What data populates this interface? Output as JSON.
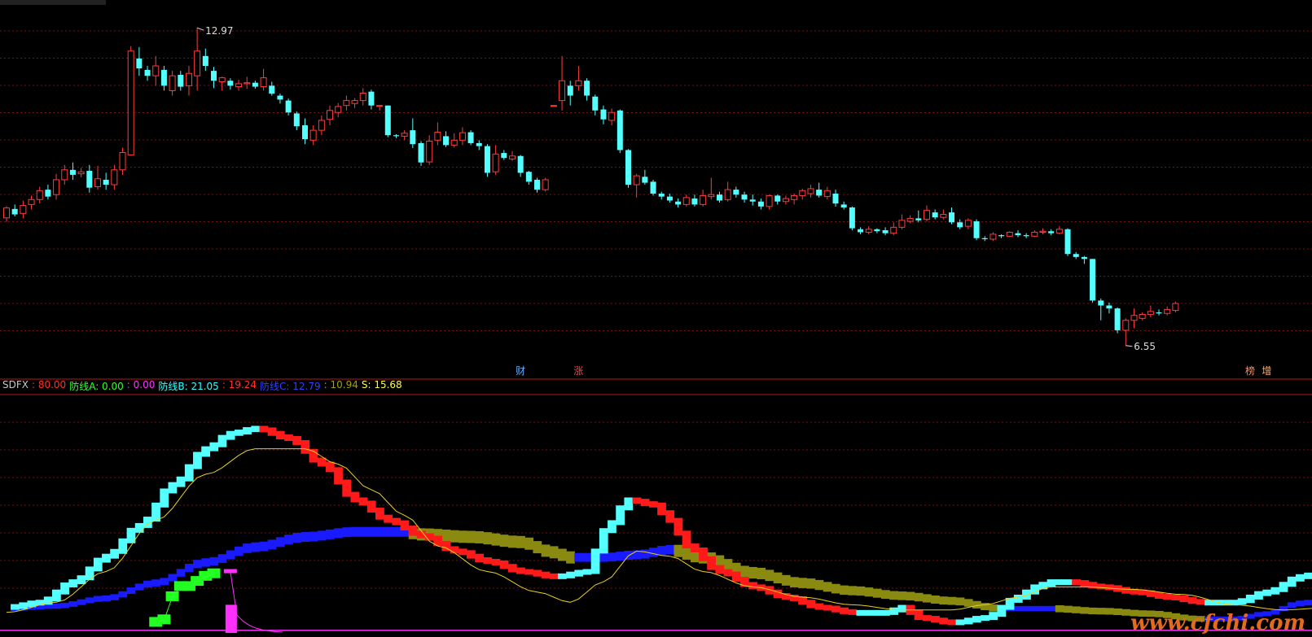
{
  "chart_data": [
    {
      "type": "candlestick",
      "price_high_label": "12.97",
      "price_low_label": "6.55",
      "ylim": [
        6.3,
        13.4
      ],
      "candles": [
        [
          9.13,
          9.33,
          9.05,
          9.37
        ],
        [
          9.31,
          9.2,
          9.16,
          9.4
        ],
        [
          9.22,
          9.38,
          9.12,
          9.48
        ],
        [
          9.4,
          9.5,
          9.3,
          9.58
        ],
        [
          9.5,
          9.68,
          9.42,
          9.76
        ],
        [
          9.7,
          9.56,
          9.5,
          9.8
        ],
        [
          9.6,
          9.9,
          9.5,
          10.02
        ],
        [
          9.9,
          10.1,
          9.8,
          10.2
        ],
        [
          10.1,
          10.0,
          9.9,
          10.25
        ],
        [
          10.02,
          10.06,
          9.95,
          10.14
        ],
        [
          10.08,
          9.74,
          9.64,
          10.2
        ],
        [
          9.76,
          9.92,
          9.7,
          10.18
        ],
        [
          9.9,
          9.8,
          9.7,
          10.04
        ],
        [
          9.8,
          10.1,
          9.7,
          10.2
        ],
        [
          10.1,
          10.45,
          10.0,
          10.55
        ],
        [
          10.4,
          12.5,
          10.4,
          12.6
        ],
        [
          12.35,
          12.15,
          12.0,
          12.58
        ],
        [
          12.12,
          12.0,
          11.9,
          12.2
        ],
        [
          12.0,
          12.2,
          11.8,
          12.4
        ],
        [
          12.12,
          11.8,
          11.7,
          12.2
        ],
        [
          11.7,
          12.0,
          11.6,
          12.1
        ],
        [
          12.02,
          11.78,
          11.7,
          12.1
        ],
        [
          11.8,
          12.05,
          11.6,
          12.2
        ],
        [
          12.0,
          12.5,
          11.7,
          12.97
        ],
        [
          12.4,
          12.2,
          12.1,
          12.55
        ],
        [
          12.1,
          11.9,
          11.75,
          12.18
        ],
        [
          11.88,
          11.96,
          11.7,
          11.98
        ],
        [
          11.9,
          11.8,
          11.72,
          11.95
        ],
        [
          11.78,
          11.84,
          11.7,
          11.92
        ],
        [
          11.84,
          11.86,
          11.74,
          11.98
        ],
        [
          11.86,
          11.78,
          11.74,
          11.9
        ],
        [
          11.78,
          11.96,
          11.7,
          12.14
        ],
        [
          11.8,
          11.64,
          11.6,
          11.88
        ],
        [
          11.6,
          11.52,
          11.44,
          11.64
        ],
        [
          11.5,
          11.26,
          11.2,
          11.54
        ],
        [
          11.24,
          10.98,
          10.9,
          11.28
        ],
        [
          11.0,
          10.72,
          10.62,
          11.14
        ],
        [
          10.7,
          10.9,
          10.6,
          11.0
        ],
        [
          10.9,
          11.1,
          10.8,
          11.2
        ],
        [
          11.12,
          11.3,
          11.0,
          11.4
        ],
        [
          11.26,
          11.38,
          11.16,
          11.45
        ],
        [
          11.4,
          11.5,
          11.3,
          11.6
        ],
        [
          11.44,
          11.5,
          11.35,
          11.55
        ],
        [
          11.5,
          11.65,
          11.4,
          11.75
        ],
        [
          11.68,
          11.4,
          11.32,
          11.72
        ],
        [
          11.4,
          11.4,
          11.3,
          11.4
        ],
        [
          11.4,
          10.8,
          10.76,
          11.4
        ],
        [
          10.8,
          10.78,
          10.74,
          10.82
        ],
        [
          10.78,
          10.84,
          10.7,
          10.9
        ],
        [
          10.9,
          10.62,
          10.54,
          11.14
        ],
        [
          10.64,
          10.25,
          10.18,
          10.68
        ],
        [
          10.26,
          10.68,
          10.2,
          10.8
        ],
        [
          10.7,
          10.86,
          10.6,
          11.06
        ],
        [
          10.78,
          10.6,
          10.56,
          10.88
        ],
        [
          10.6,
          10.7,
          10.55,
          10.84
        ],
        [
          10.7,
          10.85,
          10.6,
          10.96
        ],
        [
          10.86,
          10.64,
          10.6,
          10.9
        ],
        [
          10.64,
          10.58,
          10.5,
          10.7
        ],
        [
          10.58,
          10.04,
          9.96,
          10.62
        ],
        [
          10.06,
          10.42,
          10.0,
          10.6
        ],
        [
          10.44,
          10.34,
          10.3,
          10.5
        ],
        [
          10.32,
          10.38,
          10.28,
          10.48
        ],
        [
          10.38,
          10.04,
          9.96,
          10.4
        ],
        [
          10.06,
          9.86,
          9.8,
          10.08
        ],
        [
          9.9,
          9.7,
          9.64,
          9.94
        ],
        [
          9.7,
          9.9,
          9.66,
          9.94
        ],
        [
          11.4,
          11.4,
          11.4,
          11.4
        ],
        [
          11.5,
          11.9,
          11.3,
          12.4
        ],
        [
          11.8,
          11.6,
          11.4,
          11.9
        ],
        [
          11.8,
          11.9,
          11.7,
          12.2
        ],
        [
          11.9,
          11.6,
          11.5,
          11.95
        ],
        [
          11.58,
          11.3,
          11.2,
          11.62
        ],
        [
          11.32,
          11.12,
          11.02,
          11.4
        ],
        [
          11.1,
          11.26,
          11.0,
          11.34
        ],
        [
          11.3,
          10.5,
          10.44,
          11.32
        ],
        [
          10.5,
          9.8,
          9.74,
          10.52
        ],
        [
          9.8,
          9.98,
          9.54,
          10.02
        ],
        [
          9.96,
          9.84,
          9.8,
          10.1
        ],
        [
          9.86,
          9.62,
          9.58,
          9.9
        ],
        [
          9.62,
          9.56,
          9.5,
          9.66
        ],
        [
          9.56,
          9.48,
          9.44,
          9.62
        ],
        [
          9.46,
          9.4,
          9.34,
          9.52
        ],
        [
          9.4,
          9.54,
          9.36,
          9.6
        ],
        [
          9.52,
          9.4,
          9.36,
          9.6
        ],
        [
          9.4,
          9.58,
          9.36,
          9.7
        ],
        [
          9.56,
          9.6,
          9.5,
          9.94
        ],
        [
          9.6,
          9.48,
          9.44,
          9.66
        ],
        [
          9.5,
          9.7,
          9.46,
          9.86
        ],
        [
          9.7,
          9.6,
          9.54,
          9.76
        ],
        [
          9.6,
          9.5,
          9.44,
          9.66
        ],
        [
          9.5,
          9.46,
          9.38,
          9.6
        ],
        [
          9.46,
          9.36,
          9.3,
          9.52
        ],
        [
          9.36,
          9.58,
          9.3,
          9.6
        ],
        [
          9.58,
          9.46,
          9.4,
          9.6
        ],
        [
          9.46,
          9.52,
          9.4,
          9.58
        ],
        [
          9.5,
          9.58,
          9.4,
          9.62
        ],
        [
          9.58,
          9.68,
          9.5,
          9.72
        ],
        [
          9.62,
          9.72,
          9.54,
          9.8
        ],
        [
          9.7,
          9.58,
          9.54,
          9.84
        ],
        [
          9.56,
          9.68,
          9.5,
          9.76
        ],
        [
          9.62,
          9.42,
          9.36,
          9.7
        ],
        [
          9.4,
          9.34,
          9.3,
          9.46
        ],
        [
          9.34,
          8.92,
          8.88,
          9.36
        ],
        [
          8.9,
          8.84,
          8.8,
          8.94
        ],
        [
          8.84,
          8.9,
          8.8,
          8.96
        ],
        [
          8.9,
          8.86,
          8.82,
          8.92
        ],
        [
          8.88,
          8.82,
          8.78,
          8.94
        ],
        [
          8.82,
          8.94,
          8.78,
          9.04
        ],
        [
          8.94,
          9.08,
          8.9,
          9.2
        ],
        [
          9.06,
          9.12,
          9.02,
          9.18
        ],
        [
          9.12,
          9.08,
          9.04,
          9.28
        ],
        [
          9.1,
          9.28,
          9.06,
          9.38
        ],
        [
          9.24,
          9.14,
          9.1,
          9.3
        ],
        [
          9.14,
          9.2,
          9.1,
          9.3
        ],
        [
          9.24,
          9.04,
          9.0,
          9.34
        ],
        [
          9.04,
          8.94,
          8.9,
          9.1
        ],
        [
          8.96,
          9.08,
          8.9,
          9.12
        ],
        [
          9.06,
          8.72,
          8.68,
          9.1
        ],
        [
          8.72,
          8.7,
          8.66,
          8.76
        ],
        [
          8.7,
          8.8,
          8.66,
          8.84
        ],
        [
          8.78,
          8.76,
          8.72,
          8.8
        ],
        [
          8.76,
          8.84,
          8.74,
          8.86
        ],
        [
          8.82,
          8.78,
          8.74,
          8.88
        ],
        [
          8.78,
          8.76,
          8.72,
          8.82
        ],
        [
          8.76,
          8.84,
          8.74,
          8.88
        ],
        [
          8.84,
          8.86,
          8.8,
          8.92
        ],
        [
          8.86,
          8.82,
          8.78,
          8.9
        ],
        [
          8.82,
          8.9,
          8.8,
          8.96
        ],
        [
          8.9,
          8.4,
          8.36,
          8.92
        ],
        [
          8.4,
          8.34,
          8.3,
          8.44
        ],
        [
          8.34,
          8.3,
          8.2,
          8.36
        ],
        [
          8.3,
          7.46,
          7.42,
          8.3
        ],
        [
          7.46,
          7.36,
          7.06,
          7.5
        ],
        [
          7.36,
          7.3,
          7.2,
          7.42
        ],
        [
          7.3,
          6.86,
          6.8,
          7.32
        ],
        [
          6.86,
          7.06,
          6.55,
          7.1
        ],
        [
          7.06,
          7.16,
          6.9,
          7.3
        ],
        [
          7.1,
          7.18,
          7.06,
          7.22
        ],
        [
          7.18,
          7.24,
          7.12,
          7.36
        ],
        [
          7.22,
          7.2,
          7.16,
          7.28
        ],
        [
          7.2,
          7.28,
          7.16,
          7.34
        ],
        [
          7.26,
          7.4,
          7.22,
          7.44
        ]
      ],
      "markers": [
        {
          "label": "财",
          "index": 62,
          "color": "#6ab0ff"
        },
        {
          "label": "涨",
          "index": 69,
          "color": "#ff4040"
        },
        {
          "label": "榜",
          "index": 150,
          "color": "#ff8a5a"
        },
        {
          "label": "增",
          "index": 152,
          "color": "#ffb070"
        }
      ]
    },
    {
      "type": "indicator",
      "ylim": [
        0,
        90
      ],
      "legend": [
        {
          "text": "SDFX",
          "color": "#c8c8c8"
        },
        {
          "text": ": 80.00",
          "color": "#ff3030"
        },
        {
          "text": "防线A: 0.00",
          "color": "#30ff30"
        },
        {
          "text": ": 0.00",
          "color": "#ff30ff"
        },
        {
          "text": "防线B: 21.05",
          "color": "#30ffff"
        },
        {
          "text": ": 19.24",
          "color": "#ff3030"
        },
        {
          "text": "防线C: 12.79",
          "color": "#3040ff"
        },
        {
          "text": ": 10.94",
          "color": "#a0a000"
        },
        {
          "text": "S: 15.68",
          "color": "#ffff40"
        }
      ],
      "band_b_anchors": [
        [
          0,
          10
        ],
        [
          4,
          12
        ],
        [
          8,
          20
        ],
        [
          12,
          30
        ],
        [
          16,
          42
        ],
        [
          20,
          58
        ],
        [
          24,
          72
        ],
        [
          27,
          78
        ],
        [
          30,
          80
        ],
        [
          34,
          76
        ],
        [
          38,
          66
        ],
        [
          42,
          52
        ],
        [
          46,
          44
        ],
        [
          50,
          38
        ],
        [
          54,
          32
        ],
        [
          58,
          28
        ],
        [
          62,
          24
        ],
        [
          66,
          22
        ],
        [
          70,
          24
        ],
        [
          72,
          40
        ],
        [
          75,
          52
        ],
        [
          78,
          50
        ],
        [
          80,
          44
        ],
        [
          82,
          34
        ],
        [
          86,
          24
        ],
        [
          90,
          18
        ],
        [
          94,
          14
        ],
        [
          98,
          10
        ],
        [
          102,
          8
        ],
        [
          106,
          8
        ],
        [
          108,
          10
        ],
        [
          110,
          6
        ],
        [
          114,
          4
        ],
        [
          118,
          6
        ],
        [
          122,
          14
        ],
        [
          124,
          18
        ],
        [
          126,
          20
        ],
        [
          128,
          20
        ],
        [
          132,
          18
        ],
        [
          136,
          16
        ],
        [
          140,
          14
        ],
        [
          144,
          12
        ],
        [
          148,
          12
        ],
        [
          152,
          16
        ],
        [
          156,
          22
        ],
        [
          160,
          26
        ]
      ],
      "band_c_anchors": [
        [
          0,
          10
        ],
        [
          6,
          11
        ],
        [
          12,
          14
        ],
        [
          18,
          20
        ],
        [
          24,
          28
        ],
        [
          30,
          34
        ],
        [
          36,
          38
        ],
        [
          42,
          40
        ],
        [
          46,
          40
        ],
        [
          48,
          40
        ],
        [
          50,
          39
        ],
        [
          56,
          38
        ],
        [
          62,
          36
        ],
        [
          66,
          32
        ],
        [
          68,
          30
        ],
        [
          72,
          30
        ],
        [
          76,
          31
        ],
        [
          80,
          33
        ],
        [
          84,
          30
        ],
        [
          90,
          24
        ],
        [
          96,
          20
        ],
        [
          102,
          17
        ],
        [
          108,
          15
        ],
        [
          114,
          13
        ],
        [
          120,
          10
        ],
        [
          126,
          10
        ],
        [
          132,
          9
        ],
        [
          138,
          8
        ],
        [
          144,
          6
        ],
        [
          148,
          6
        ],
        [
          152,
          8
        ],
        [
          156,
          12
        ],
        [
          160,
          14
        ]
      ],
      "s_anchors": [
        [
          0,
          8
        ],
        [
          6,
          12
        ],
        [
          12,
          24
        ],
        [
          18,
          44
        ],
        [
          24,
          62
        ],
        [
          30,
          72
        ],
        [
          36,
          72
        ],
        [
          40,
          66
        ],
        [
          44,
          56
        ],
        [
          48,
          46
        ],
        [
          52,
          34
        ],
        [
          58,
          24
        ],
        [
          64,
          16
        ],
        [
          68,
          12
        ],
        [
          72,
          20
        ],
        [
          76,
          32
        ],
        [
          80,
          30
        ],
        [
          84,
          24
        ],
        [
          90,
          18
        ],
        [
          96,
          14
        ],
        [
          102,
          11
        ],
        [
          108,
          9
        ],
        [
          114,
          9
        ],
        [
          118,
          11
        ],
        [
          122,
          14
        ],
        [
          126,
          18
        ],
        [
          130,
          18
        ],
        [
          136,
          17
        ],
        [
          142,
          15
        ],
        [
          148,
          11
        ],
        [
          154,
          9
        ],
        [
          160,
          10
        ]
      ],
      "green_blocks": [
        [
          18,
          4
        ],
        [
          19,
          5
        ],
        [
          20,
          14
        ],
        [
          21,
          18
        ],
        [
          22,
          18
        ],
        [
          23,
          20
        ],
        [
          24,
          22
        ],
        [
          25,
          23
        ]
      ],
      "magenta_block": {
        "index": 27,
        "value": 11,
        "tip_value": 24
      },
      "magenta_baseline": 1
    }
  ],
  "watermark": "www.cfchi.com"
}
